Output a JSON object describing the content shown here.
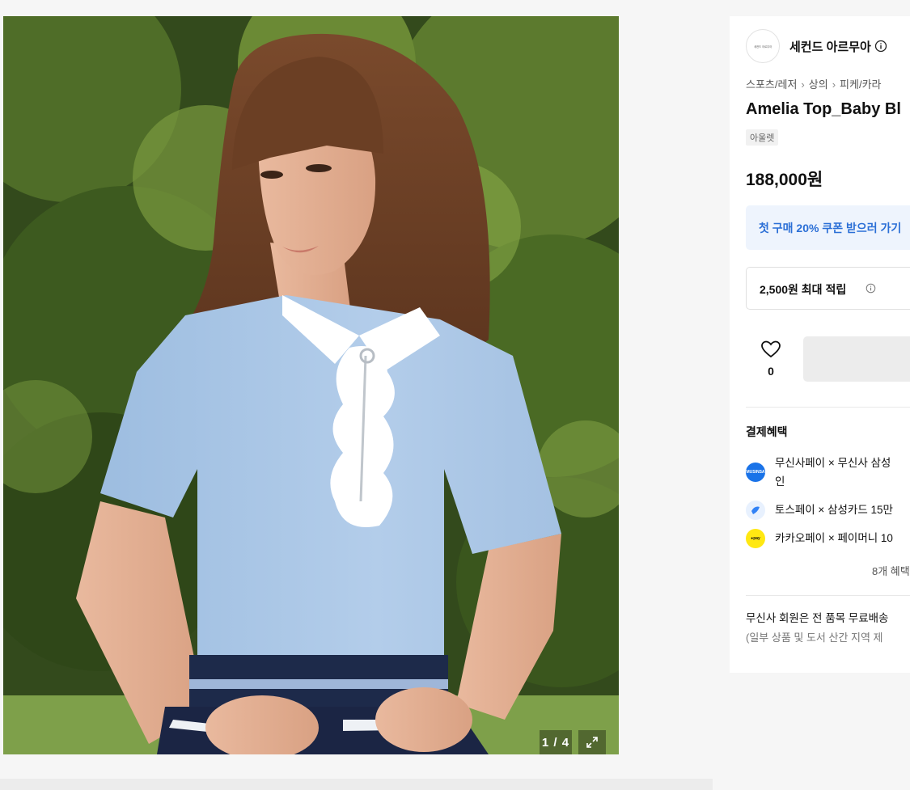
{
  "gallery": {
    "counter": "1 / 4",
    "image_icon": "expand-icon",
    "image_description_icon": "product-photo"
  },
  "brand": {
    "logo_text": "세컨드 아르무아",
    "name": "세컨드 아르무아",
    "info_icon": "info-icon"
  },
  "breadcrumb": [
    "스포츠/레저",
    "상의",
    "피케/카라"
  ],
  "product": {
    "title": "Amelia Top_Baby Bl",
    "tag": "아울렛",
    "price": "188,000원"
  },
  "coupon": {
    "text": "첫 구매 20% 쿠폰 받으러 가기"
  },
  "points": {
    "text": "2,500원 최대 적립"
  },
  "like": {
    "icon": "heart-icon",
    "count": "0"
  },
  "benefits": {
    "title": "결제혜택",
    "items": [
      {
        "icon": "musinsa-pay-icon",
        "color": "#1a73e8",
        "text_line1": "무신사페이 × 무신사 삼성",
        "text_line2": "인"
      },
      {
        "icon": "toss-pay-icon",
        "color": "#3182f6",
        "text_line1": "토스페이 × 삼성카드 15만"
      },
      {
        "icon": "kakao-pay-icon",
        "color": "#ffe812",
        "text_line1": "카카오페이 × 페이머니 10"
      }
    ],
    "more": "8개 혜택"
  },
  "membership": {
    "line1": "무신사 회원은 전 품목 무료배송",
    "line2": "(일부 상품 및 도서 산간 지역 제"
  },
  "colors": {
    "accent_blue": "#2b6fd6",
    "coupon_bg": "#eef4fd",
    "shirt": "#a9c6e6"
  }
}
